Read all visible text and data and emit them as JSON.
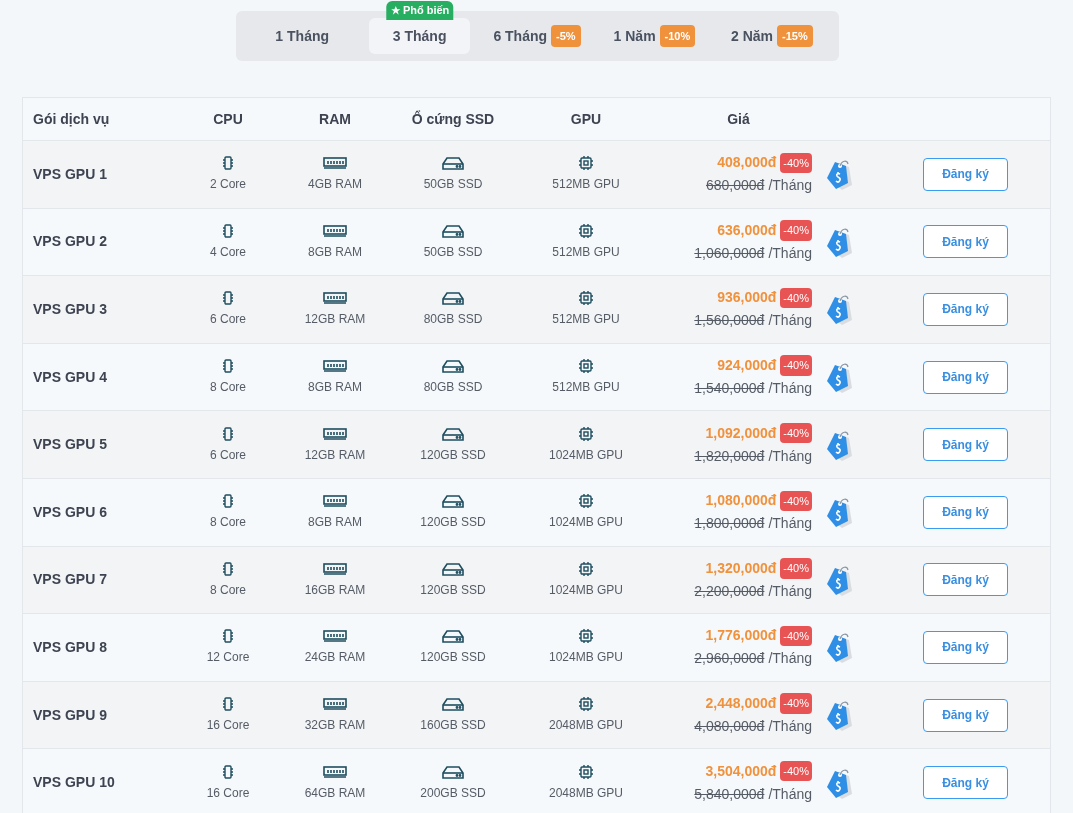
{
  "tabs": [
    {
      "label": "1 Tháng",
      "selected": false
    },
    {
      "label": "3 Tháng",
      "selected": true,
      "badge": "Phổ biến"
    },
    {
      "label": "6 Tháng",
      "selected": false,
      "discount": "-5%"
    },
    {
      "label": "1 Năm",
      "selected": false,
      "discount": "-10%"
    },
    {
      "label": "2 Năm",
      "selected": false,
      "discount": "-15%"
    }
  ],
  "table": {
    "columns": [
      "Gói dịch vụ",
      "CPU",
      "RAM",
      "Ổ cứng SSD",
      "GPU",
      "Giá"
    ],
    "rows": [
      {
        "name": "VPS GPU 1",
        "cpu": "2 Core",
        "ram": "4GB RAM",
        "ssd": "50GB SSD",
        "gpu": "512MB GPU",
        "price": "408,000đ",
        "discount": "-40%",
        "old_price": "680,000đ",
        "unit": "/Tháng",
        "button": "Đăng ký"
      },
      {
        "name": "VPS GPU 2",
        "cpu": "4 Core",
        "ram": "8GB RAM",
        "ssd": "50GB SSD",
        "gpu": "512MB GPU",
        "price": "636,000đ",
        "discount": "-40%",
        "old_price": "1,060,000đ",
        "unit": "/Tháng",
        "button": "Đăng ký"
      },
      {
        "name": "VPS GPU 3",
        "cpu": "6 Core",
        "ram": "12GB RAM",
        "ssd": "80GB SSD",
        "gpu": "512MB GPU",
        "price": "936,000đ",
        "discount": "-40%",
        "old_price": "1,560,000đ",
        "unit": "/Tháng",
        "button": "Đăng ký"
      },
      {
        "name": "VPS GPU 4",
        "cpu": "8 Core",
        "ram": "8GB RAM",
        "ssd": "80GB SSD",
        "gpu": "512MB GPU",
        "price": "924,000đ",
        "discount": "-40%",
        "old_price": "1,540,000đ",
        "unit": "/Tháng",
        "button": "Đăng ký"
      },
      {
        "name": "VPS GPU 5",
        "cpu": "6 Core",
        "ram": "12GB RAM",
        "ssd": "120GB SSD",
        "gpu": "1024MB GPU",
        "price": "1,092,000đ",
        "discount": "-40%",
        "old_price": "1,820,000đ",
        "unit": "/Tháng",
        "button": "Đăng ký"
      },
      {
        "name": "VPS GPU 6",
        "cpu": "8 Core",
        "ram": "8GB RAM",
        "ssd": "120GB SSD",
        "gpu": "1024MB GPU",
        "price": "1,080,000đ",
        "discount": "-40%",
        "old_price": "1,800,000đ",
        "unit": "/Tháng",
        "button": "Đăng ký"
      },
      {
        "name": "VPS GPU 7",
        "cpu": "8 Core",
        "ram": "16GB RAM",
        "ssd": "120GB SSD",
        "gpu": "1024MB GPU",
        "price": "1,320,000đ",
        "discount": "-40%",
        "old_price": "2,200,000đ",
        "unit": "/Tháng",
        "button": "Đăng ký"
      },
      {
        "name": "VPS GPU 8",
        "cpu": "12 Core",
        "ram": "24GB RAM",
        "ssd": "120GB SSD",
        "gpu": "1024MB GPU",
        "price": "1,776,000đ",
        "discount": "-40%",
        "old_price": "2,960,000đ",
        "unit": "/Tháng",
        "button": "Đăng ký"
      },
      {
        "name": "VPS GPU 9",
        "cpu": "16 Core",
        "ram": "32GB RAM",
        "ssd": "160GB SSD",
        "gpu": "2048MB GPU",
        "price": "2,448,000đ",
        "discount": "-40%",
        "old_price": "4,080,000đ",
        "unit": "/Tháng",
        "button": "Đăng ký"
      },
      {
        "name": "VPS GPU 10",
        "cpu": "16 Core",
        "ram": "64GB RAM",
        "ssd": "200GB SSD",
        "gpu": "2048MB GPU",
        "price": "3,504,000đ",
        "discount": "-40%",
        "old_price": "5,840,000đ",
        "unit": "/Tháng",
        "button": "Đăng ký"
      }
    ]
  }
}
